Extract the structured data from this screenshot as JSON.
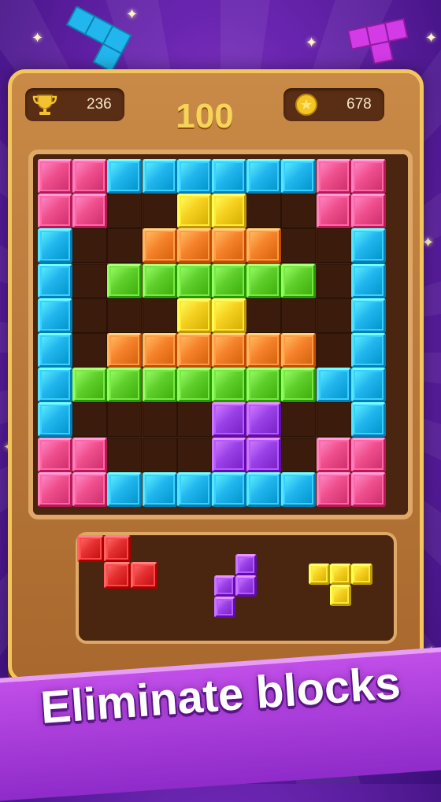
{
  "hud": {
    "best_score": "236",
    "score": "100",
    "coins": "678",
    "trophy_icon": "trophy-icon",
    "coin_icon": "coin-icon"
  },
  "colors": {
    "pink": "#f04f8d",
    "blue": "#22b6ee",
    "yellow": "#f5d01f",
    "orange": "#f6832b",
    "green": "#5fcf2c",
    "purple": "#9a42e8",
    "red": "#e43030"
  },
  "board": {
    "rows": 10,
    "cols": 10,
    "grid": [
      "ppbbbbbbpp",
      "pp..yy..pp",
      "b..oooo..b",
      "b.gggggg.b",
      "b...yy...b",
      "b.oooooo.b",
      "bgggggggbb",
      "b....uu..b",
      "pp...uu.pp",
      "ppbbbbbbpp"
    ]
  },
  "pieces": [
    {
      "name": "red-z-piece",
      "color": "red",
      "cells": [
        [
          0,
          0
        ],
        [
          0,
          1
        ],
        [
          1,
          1
        ],
        [
          1,
          2
        ]
      ]
    },
    {
      "name": "purple-s-piece",
      "color": "purple",
      "cells": [
        [
          0,
          1
        ],
        [
          1,
          0
        ],
        [
          1,
          1
        ],
        [
          2,
          0
        ]
      ]
    },
    {
      "name": "yellow-t-piece",
      "color": "yellow",
      "cells": [
        [
          0,
          0
        ],
        [
          0,
          1
        ],
        [
          0,
          2
        ],
        [
          1,
          1
        ]
      ]
    }
  ],
  "banner": {
    "text": "Eliminate blocks"
  }
}
